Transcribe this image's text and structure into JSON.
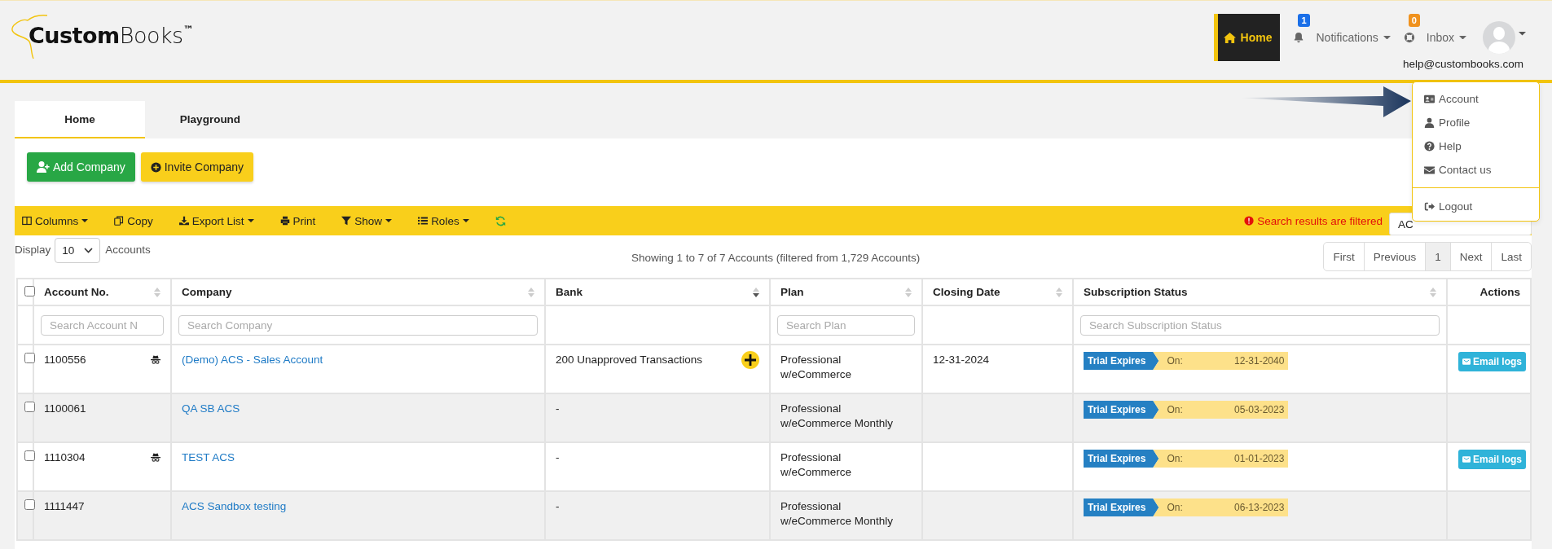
{
  "header": {
    "logo": {
      "bold": "Custom",
      "light": "Books",
      "mark": "™"
    },
    "nav": [
      {
        "kind": "home",
        "label": "Home",
        "selected": true
      },
      {
        "kind": "notifications",
        "label": "Notifications",
        "selected": false,
        "badge": "1",
        "color": "#1a6fe8"
      },
      {
        "kind": "inbox",
        "label": "Inbox",
        "selected": false,
        "badge": "0",
        "color": "#f0921e"
      }
    ],
    "user_email": "help@custombooks.com"
  },
  "user_menu": {
    "items": [
      {
        "kind": "account",
        "label": "Account"
      },
      {
        "kind": "profile",
        "label": "Profile"
      },
      {
        "kind": "help",
        "label": "Help"
      },
      {
        "kind": "contact",
        "label": "Contact us"
      }
    ],
    "footer_items": [
      {
        "kind": "logout",
        "label": "Logout"
      }
    ]
  },
  "tabs": [
    {
      "label": "Home",
      "selected": true
    },
    {
      "label": "Playground",
      "selected": false
    }
  ],
  "actions": [
    {
      "kind": "add",
      "label": "Add Company"
    },
    {
      "kind": "invite",
      "label": "Invite Company"
    }
  ],
  "toolbar": {
    "tools": [
      {
        "kind": "columns",
        "label": "Columns",
        "dropdown": true
      },
      {
        "kind": "copy",
        "label": "Copy",
        "dropdown": false
      },
      {
        "kind": "export",
        "label": "Export List",
        "dropdown": true
      },
      {
        "kind": "print",
        "label": "Print",
        "dropdown": false
      },
      {
        "kind": "show",
        "label": "Show",
        "dropdown": true
      },
      {
        "kind": "roles",
        "label": "Roles",
        "dropdown": true
      },
      {
        "kind": "refresh",
        "dropdown": false
      }
    ],
    "filter_notice": "Search results are filtered",
    "filter_field": {
      "value": "AC"
    }
  },
  "display": {
    "label": "Display",
    "value": "10",
    "suffix": "Accounts"
  },
  "summary": "Showing 1 to 7 of 7 Accounts (filtered from 1,729 Accounts)",
  "pagination": [
    {
      "label": "First",
      "selected": false
    },
    {
      "label": "Previous",
      "selected": false
    },
    {
      "label": "1",
      "selected": true
    },
    {
      "label": "Next",
      "selected": false
    },
    {
      "label": "Last",
      "selected": false
    }
  ],
  "table": {
    "select_all": {
      "checked": false
    },
    "columns": [
      {
        "label": "Account No.",
        "sortable": true,
        "sort_desc": false,
        "placeholder": "Search Account N"
      },
      {
        "label": "Company",
        "sortable": true,
        "sort_desc": false,
        "placeholder": "Search Company"
      },
      {
        "label": "Bank",
        "sortable": true,
        "sort_desc": true
      },
      {
        "label": "Plan",
        "sortable": true,
        "sort_desc": false,
        "placeholder": "Search Plan"
      },
      {
        "label": "Closing Date",
        "sortable": true,
        "sort_desc": false
      },
      {
        "label": "Subscription Status",
        "sortable": true,
        "sort_desc": false,
        "placeholder": "Search Subscription Status"
      },
      {
        "label": "Actions",
        "sortable": false
      }
    ],
    "rows": [
      {
        "checked": false,
        "account": "1100556",
        "private": true,
        "company": "(Demo) ACS - Sales Account",
        "bank": "200 Unapproved Transactions",
        "bank_action": true,
        "plan": "Professional w/eCommerce",
        "closing_date": "12-31-2024",
        "status": {
          "label": "Trial Expires",
          "on": "On:",
          "date": "12-31-2040"
        },
        "email_logs": "Email logs"
      },
      {
        "checked": false,
        "account": "1100061",
        "private": false,
        "company": "QA SB ACS",
        "bank": "-",
        "bank_action": false,
        "plan": "Professional w/eCommerce Monthly",
        "status": {
          "label": "Trial Expires",
          "on": "On:",
          "date": "05-03-2023"
        }
      },
      {
        "checked": false,
        "account": "1110304",
        "private": true,
        "company": "TEST ACS",
        "bank": "-",
        "bank_action": false,
        "plan": "Professional w/eCommerce",
        "status": {
          "label": "Trial Expires",
          "on": "On:",
          "date": "01-01-2023"
        },
        "email_logs": "Email logs"
      },
      {
        "checked": false,
        "account": "1111447",
        "private": false,
        "company": "ACS Sandbox testing",
        "bank": "-",
        "bank_action": false,
        "plan": "Professional w/eCommerce Monthly",
        "status": {
          "label": "Trial Expires",
          "on": "On:",
          "date": "06-13-2023"
        }
      }
    ]
  }
}
